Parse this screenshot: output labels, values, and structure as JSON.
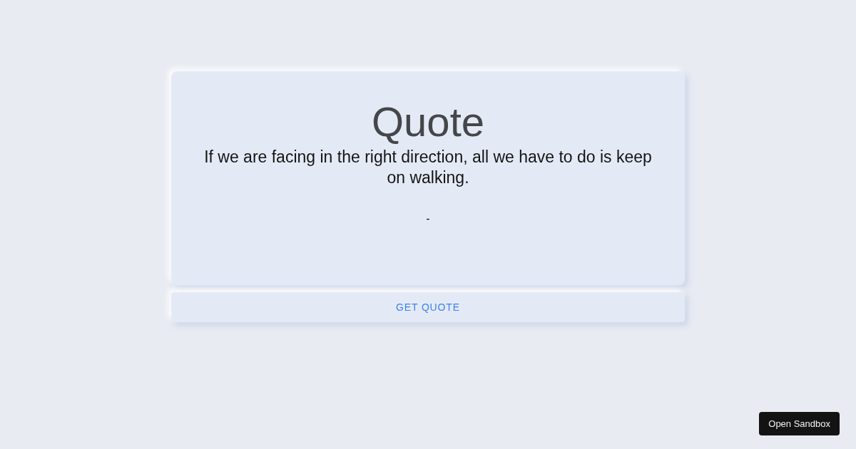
{
  "card": {
    "title": "Quote",
    "quote": "If we are facing in the right direction, all we have to do is keep on walking.",
    "author": "-"
  },
  "get_quote_button": {
    "label": "GET QUOTE"
  },
  "sandbox_button": {
    "label": "Open Sandbox"
  }
}
